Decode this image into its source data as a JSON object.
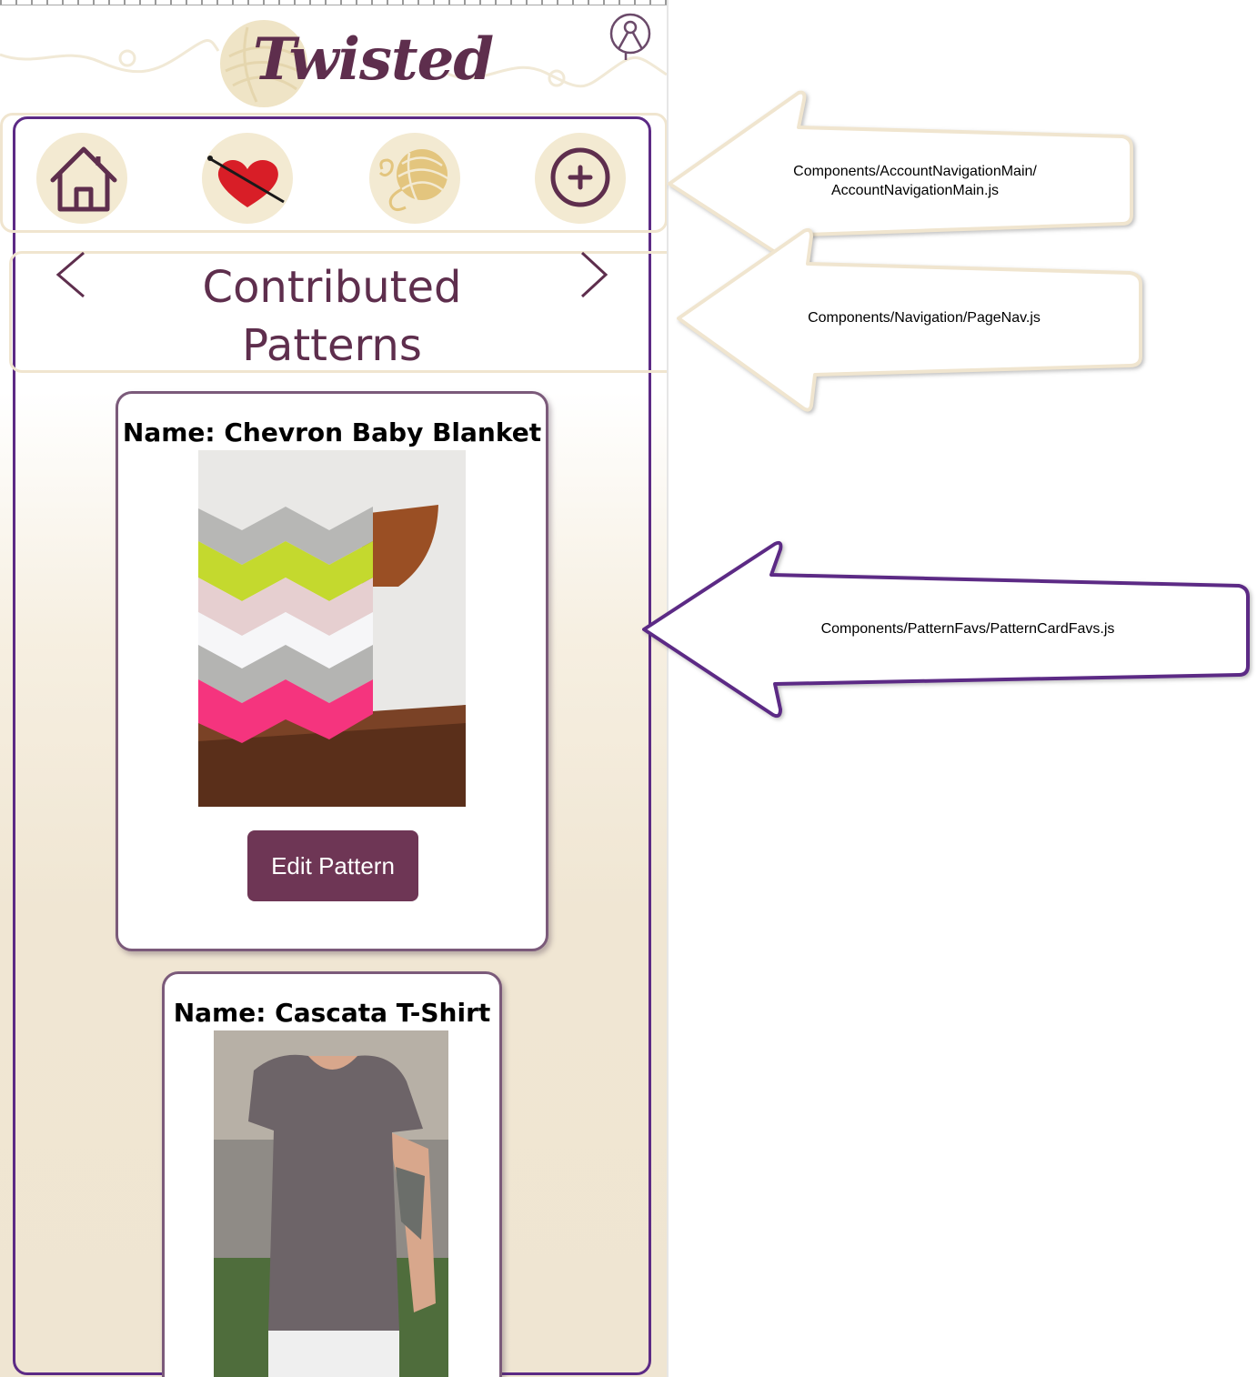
{
  "app": {
    "logo_text": "Twisted"
  },
  "account_nav": {
    "items": [
      {
        "icon": "home-icon"
      },
      {
        "icon": "favorites-heart-icon"
      },
      {
        "icon": "yarn-ball-icon"
      },
      {
        "icon": "add-icon"
      }
    ]
  },
  "page_nav": {
    "title_line1": "Contributed",
    "title_line2": "Patterns",
    "prev_icon": "chevron-left-icon",
    "next_icon": "chevron-right-icon"
  },
  "patterns": [
    {
      "title": "Name: Chevron Baby Blanket",
      "button_label": "Edit Pattern"
    },
    {
      "title": "Name: Cascata T-Shirt"
    }
  ],
  "annotations": [
    {
      "line1": "Components/AccountNavigationMain/",
      "line2": "AccountNavigationMain.js",
      "color": "#f0e5cf"
    },
    {
      "line1": "Components/Navigation/PageNav.js",
      "color": "#f0e5cf"
    },
    {
      "line1": "Components/PatternFavs/PatternCardFavs.js",
      "color": "#5c2a85"
    }
  ],
  "colors": {
    "brand_plum": "#5e2e4d",
    "frame_purple": "#5c2a85",
    "cream": "#f3ead2",
    "button": "#6e3655"
  }
}
